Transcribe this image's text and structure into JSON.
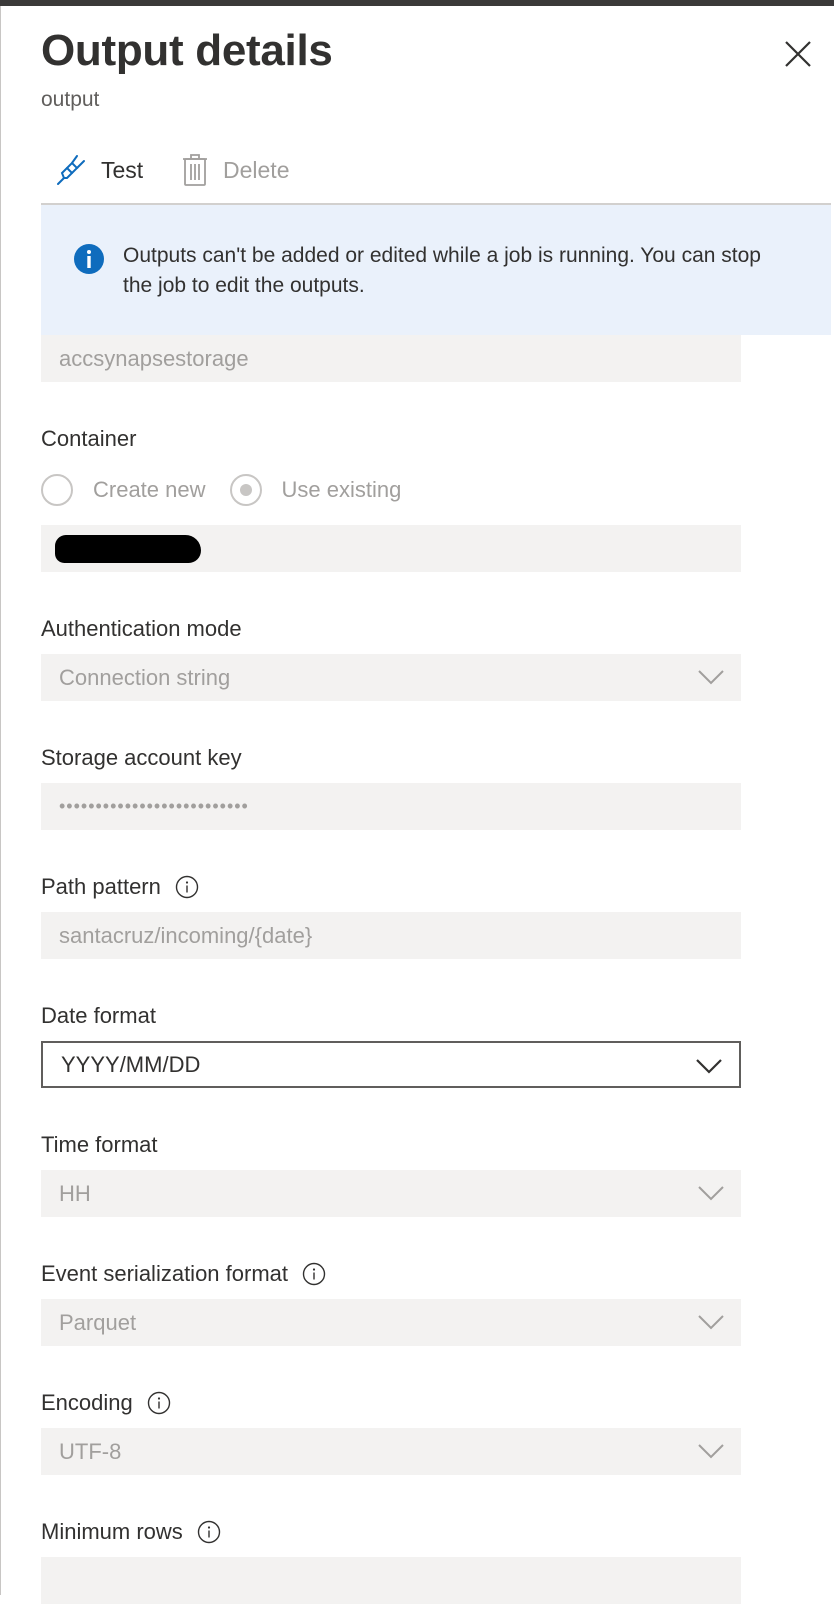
{
  "panel": {
    "title": "Output details",
    "subtitle": "output"
  },
  "toolbar": {
    "test_label": "Test",
    "delete_label": "Delete"
  },
  "banner": {
    "message": "Outputs can't be added or edited while a job is running. You can stop the job to edit the outputs."
  },
  "form": {
    "storage_account_value": "accsynapsestorage",
    "container_label": "Container",
    "container_options": [
      "Create new",
      "Use existing"
    ],
    "container_selected": "Use existing",
    "auth_mode_label": "Authentication mode",
    "auth_mode_value": "Connection string",
    "storage_key_label": "Storage account key",
    "storage_key_value": "••••••••••••••••••••••••••",
    "path_pattern_label": "Path pattern",
    "path_pattern_value": "santacruz/incoming/{date}",
    "date_format_label": "Date format",
    "date_format_value": "YYYY/MM/DD",
    "time_format_label": "Time format",
    "time_format_value": "HH",
    "serialization_label": "Event serialization format",
    "serialization_value": "Parquet",
    "encoding_label": "Encoding",
    "encoding_value": "UTF-8",
    "min_rows_label": "Minimum rows"
  },
  "colors": {
    "banner_bg": "#eaf1fb",
    "info_blue": "#0f6cbd",
    "disabled_field_bg": "#f3f2f1",
    "disabled_text": "#a19f9d"
  }
}
